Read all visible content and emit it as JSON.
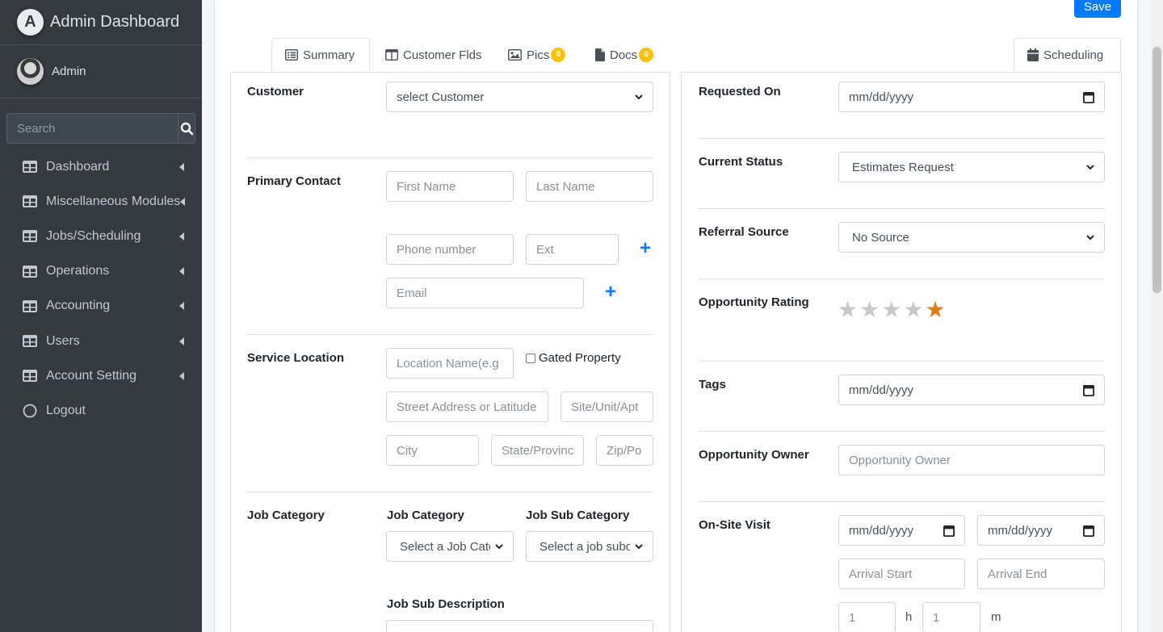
{
  "sidebar": {
    "brand": "Admin Dashboard",
    "user": "Admin",
    "search_placeholder": "Search",
    "items": [
      {
        "label": "Dashboard"
      },
      {
        "label": "Miscellaneous Modules"
      },
      {
        "label": "Jobs/Scheduling"
      },
      {
        "label": "Operations"
      },
      {
        "label": "Accounting"
      },
      {
        "label": "Users"
      },
      {
        "label": "Account Setting"
      },
      {
        "label": "Logout"
      }
    ]
  },
  "toolbar": {
    "save_label": "Save"
  },
  "tabs": {
    "summary": "Summary",
    "customer_flds": "Customer Flds",
    "pics": "Pics",
    "pics_count": "0",
    "docs": "Docs",
    "docs_count": "0",
    "scheduling": "Scheduling"
  },
  "left": {
    "customer_label": "Customer",
    "customer_value": "select Customer",
    "primary_contact_label": "Primary Contact",
    "first_name": "First Name",
    "last_name": "Last Name",
    "phone": "Phone number",
    "ext": "Ext",
    "email": "Email",
    "service_location_label": "Service Location",
    "location_name": "Location Name(e.g l",
    "gated_property": "Gated Property",
    "street": "Street Address or Latitude",
    "site_unit": "Site/Unit/Apt",
    "city": "City",
    "state": "State/Provinc",
    "zip": "Zip/Po",
    "job_category_label": "Job Category",
    "job_category_sub_label": "Job Category",
    "job_sub_category_label": "Job Sub Category",
    "job_category_value": "Select a Job Cate",
    "job_sub_category_value": "Select a job subc",
    "job_sub_description_label": "Job Sub Description"
  },
  "right": {
    "requested_on_label": "Requested On",
    "date_placeholder": "mm/dd/yyyy",
    "current_status_label": "Current Status",
    "current_status_value": "Estimates Request",
    "referral_source_label": "Referral Source",
    "referral_source_value": "No Source",
    "opportunity_rating_label": "Opportunity Rating",
    "rating": {
      "value": 1,
      "max": 5
    },
    "tags_label": "Tags",
    "opportunity_owner_label": "Opportunity Owner",
    "opportunity_owner_placeholder": "Opportunity Owner",
    "onsite_visit_label": "On-Site Visit",
    "arrival_start": "Arrival Start",
    "arrival_end": "Arrival End",
    "hours_value": "1",
    "hours_unit": "h",
    "minutes_value": "1",
    "minutes_unit": "m"
  },
  "colors": {
    "sidebar": "#343a40",
    "primary": "#007bff",
    "badge": "#ffc107",
    "star_on": "#e07b1a"
  }
}
